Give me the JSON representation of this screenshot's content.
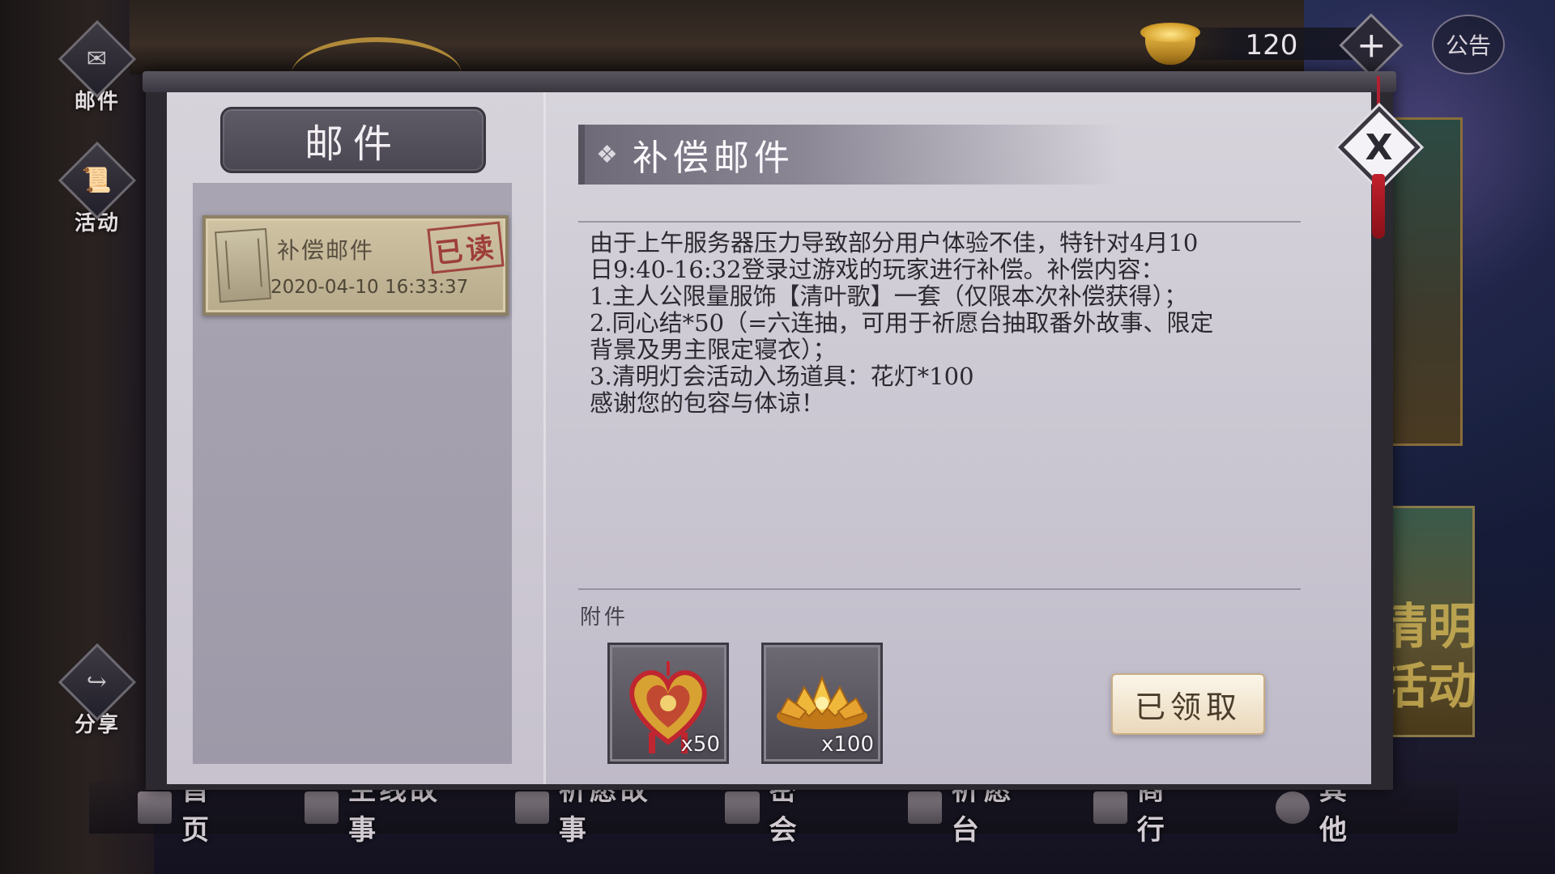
{
  "sidebar": {
    "mail_label": "邮件",
    "activity_label": "活动",
    "share_label": "分享"
  },
  "currency": {
    "value": "120",
    "plus_symbol": "+",
    "notice_label": "公告"
  },
  "mail_panel": {
    "title": "邮件",
    "items": [
      {
        "subject": "补偿邮件",
        "date": "2020-04-10 16:33:37",
        "status": "已读"
      }
    ]
  },
  "detail": {
    "title": "补偿邮件",
    "body": "由于上午服务器压力导致部分用户体验不佳，特针对4月10\n日9:40-16:32登录过游戏的玩家进行补偿。补偿内容：\n1.主人公限量服饰【清叶歌】一套（仅限本次补偿获得）；\n2.同心结*50（=六连抽，可用于祈愿台抽取番外故事、限定\n背景及男主限定寝衣）；\n3.清明灯会活动入场道具：花灯*100\n感谢您的包容与体谅！",
    "attachments_label": "附件",
    "attachments": [
      {
        "icon": "tongxinjie-knot-icon",
        "qty": "x50"
      },
      {
        "icon": "lotus-lantern-icon",
        "qty": "x100"
      }
    ],
    "claim_label": "已领取",
    "close_label": "X"
  },
  "bottom_nav": [
    {
      "label": "首页"
    },
    {
      "label": "主线故事"
    },
    {
      "label": "祈愿故事"
    },
    {
      "label": "密会"
    },
    {
      "label": "祈愿台"
    },
    {
      "label": "商行"
    },
    {
      "label": "其他"
    }
  ],
  "banner_text": "清明\n活动",
  "colors": {
    "modal_bg": "#cbc7d2",
    "mail_item_bg": "#cfc3a4",
    "stamp_red": "#962828",
    "claim_btn": "#f4ead6",
    "gold": "#d9a630"
  }
}
